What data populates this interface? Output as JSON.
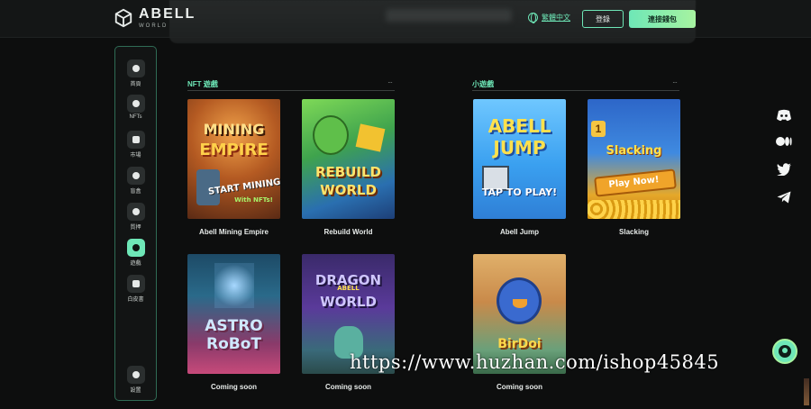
{
  "header": {
    "logo_name": "ABELL",
    "logo_sub": "WORLD",
    "language": "繁體中文",
    "login_label": "登錄",
    "wallet_label": "連接錢包"
  },
  "sidebar": {
    "items": [
      {
        "label": "首頁",
        "icon": "home-icon"
      },
      {
        "label": "NFTs",
        "icon": "nft-icon"
      },
      {
        "label": "市場",
        "icon": "market-icon"
      },
      {
        "label": "盲盒",
        "icon": "blindbox-icon"
      },
      {
        "label": "質押",
        "icon": "stake-icon"
      },
      {
        "label": "遊戲",
        "icon": "game-icon",
        "active": true
      },
      {
        "label": "白皮書",
        "icon": "whitepaper-icon"
      }
    ],
    "settings_label": "設置"
  },
  "sections": {
    "nft": {
      "title": "NFT 遊戲",
      "more": "···"
    },
    "mini": {
      "title": "小遊戲",
      "more": "···"
    }
  },
  "cards": {
    "mining": {
      "name": "Abell Mining Empire",
      "art_top": "MINING",
      "art_mid": "EMPIRE",
      "art_cta": "START MINING!",
      "art_sub": "With NFTs!"
    },
    "rebuild": {
      "name": "Rebuild World",
      "art_top": "REBUILD",
      "art_mid": "WORLD"
    },
    "jump": {
      "name": "Abell Jump",
      "art_top": "ABELL",
      "art_mid": "JUMP",
      "art_cta": "TAP TO PLAY!"
    },
    "slacking": {
      "name": "Slacking",
      "art_top": "Slacking",
      "art_cta": "Play Now!",
      "art_num": "1"
    },
    "astro": {
      "name": "Coming soon",
      "art_top": "ASTRO",
      "art_mid": "RoBoT"
    },
    "dragon": {
      "name": "Coming soon",
      "art_top": "DRAGON",
      "art_mid": "WORLD",
      "art_badge": "ABELL"
    },
    "birdie": {
      "name": "Coming soon",
      "art_top": "BirDoi"
    }
  },
  "social": [
    "discord-icon",
    "medium-icon",
    "twitter-icon",
    "telegram-icon"
  ],
  "watermark": "https://www.huzhan.com/ishop45845",
  "colors": {
    "accent": "#6ee7b7",
    "background": "#0d0e0e"
  }
}
